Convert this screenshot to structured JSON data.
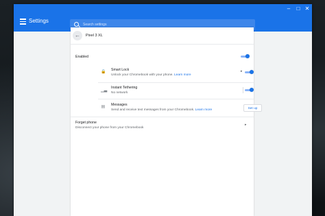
{
  "window": {
    "minimize": "–",
    "maximize": "□",
    "close": "✕"
  },
  "header": {
    "title": "Settings",
    "search_placeholder": "Search settings"
  },
  "page": {
    "device_name": "Pixel 3 XL",
    "back_glyph": "←"
  },
  "enabled": {
    "label": "Enabled",
    "on": true
  },
  "smart_lock": {
    "title": "Smart Lock",
    "subtitle": "Unlock your Chromebook with your phone.",
    "link": "Learn more",
    "on": true
  },
  "instant_tethering": {
    "title": "Instant Tethering",
    "subtitle": "No network",
    "on": true
  },
  "messages": {
    "title": "Messages",
    "subtitle": "Send and receive text messages from your Chromebook.",
    "link": "Learn more",
    "button": "Set up"
  },
  "forget_phone": {
    "title": "Forget phone",
    "subtitle": "Disconnect your phone from your Chromebook"
  },
  "colors": {
    "accent": "#1a73e8",
    "toggle_track": "#8ab4f8"
  }
}
